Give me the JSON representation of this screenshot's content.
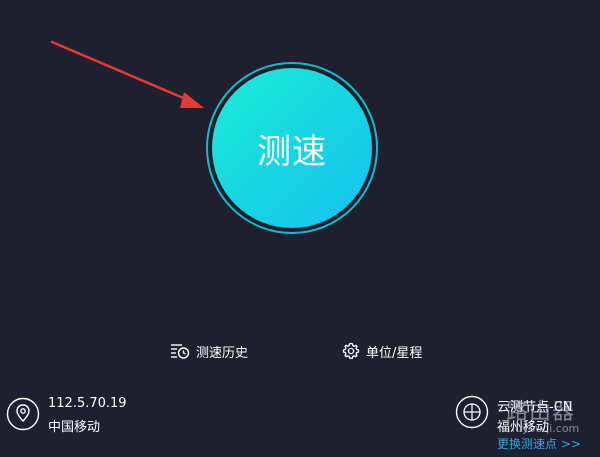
{
  "speed_test": {
    "label": "测速"
  },
  "actions": {
    "history_label": "测速历史",
    "units_label": "单位/星程"
  },
  "connection": {
    "ip": "112.5.70.19",
    "isp": "中国移动"
  },
  "node": {
    "name": "云测节点-CN",
    "isp": "福州移动",
    "switch_label": "更换测速点 >>"
  },
  "watermark": {
    "text": "路由器",
    "sub": "luyouqi.com"
  },
  "colors": {
    "background": "#1e2030",
    "button_gradient_start": "#19ecd4",
    "button_gradient_end": "#18c0ee",
    "ring": "#17b9c7",
    "link": "#2aa8e8",
    "annotation_arrow": "#e53935"
  }
}
